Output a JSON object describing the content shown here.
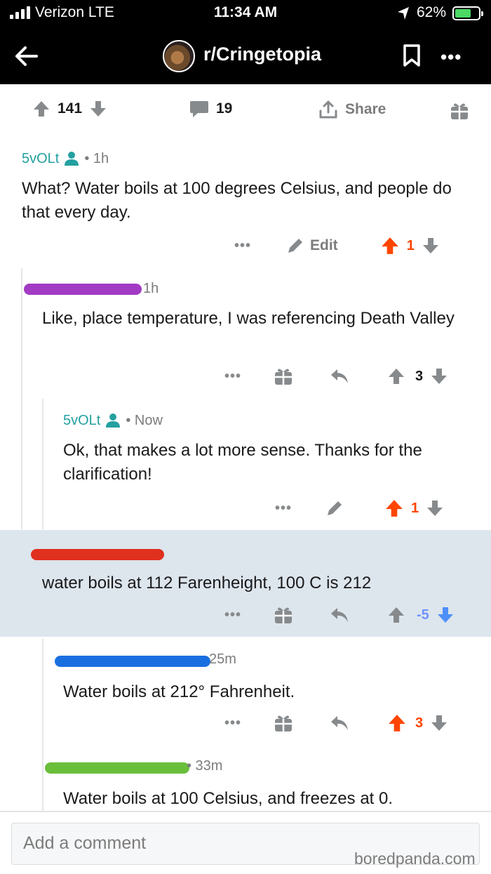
{
  "status_bar": {
    "carrier": "Verizon  LTE",
    "time": "11:34 AM",
    "battery": "62%",
    "battery_level": 0.62
  },
  "nav": {
    "subreddit": "r/Cringetopia",
    "back_icon": "back-arrow-icon",
    "bookmark_icon": "bookmark-icon",
    "more_icon": "more-icon"
  },
  "post_actions": {
    "score": "141",
    "comments": "19",
    "share": "Share"
  },
  "comments": [
    {
      "user": "5vOLt",
      "time": "• 1h",
      "body": "What? Water boils at 100 degrees Celsius, and people do that every day.",
      "edit": "Edit",
      "score": "1"
    },
    {
      "time": "1h",
      "body": "Like, place temperature, I was referencing Death Valley",
      "score": "3"
    },
    {
      "user": "5vOLt",
      "time": "• Now",
      "body": "Ok, that makes a lot more sense. Thanks for the clarification!",
      "score": "1"
    },
    {
      "body": "water boils at 112 Farenheight, 100 C is 212",
      "score": "-5"
    },
    {
      "time": "25m",
      "body": "Water boils at 212° Fahrenheit.",
      "score": "3"
    },
    {
      "time": "• 33m",
      "body": "Water boils at 100 Celsius, and freezes at 0."
    }
  ],
  "compose": {
    "placeholder": "Add a comment"
  },
  "watermark": "boredpanda.com",
  "colors": {
    "upvote": "#ff4500",
    "downvote": "#7193ff",
    "username": "#24a0a0",
    "highlight": "#dde5ed"
  }
}
